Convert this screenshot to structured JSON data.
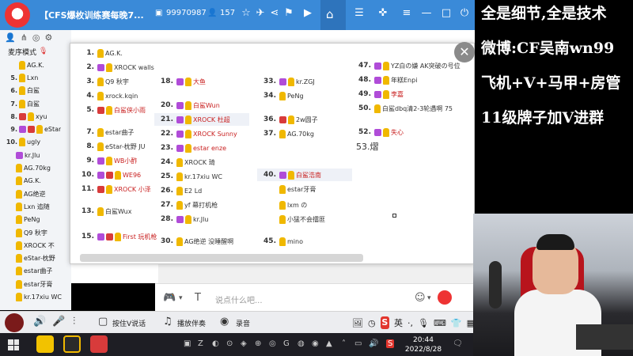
{
  "topbar": {
    "title": "【CFS爆枚训练赛每晚7...",
    "room_id": "99970987",
    "viewers": "157"
  },
  "left_panel": {
    "sort_label": "麦序模式",
    "rows": [
      {
        "num": "",
        "badges": [
          "cup"
        ],
        "name": "AG.K."
      },
      {
        "num": "5.",
        "badges": [
          "cup"
        ],
        "name": "Lxn"
      },
      {
        "num": "6.",
        "badges": [
          "cup"
        ],
        "name": "白鲨"
      },
      {
        "num": "7.",
        "badges": [
          "cup"
        ],
        "name": "白鲨"
      },
      {
        "num": "8.",
        "badges": [
          "red",
          "cup"
        ],
        "name": "xyu"
      },
      {
        "num": "9.",
        "badges": [
          "v",
          "red",
          "cup"
        ],
        "name": "eStar"
      },
      {
        "num": "10.",
        "badges": [
          "cup"
        ],
        "name": "ugly"
      }
    ],
    "sub_rows": [
      {
        "badges": [
          "v"
        ],
        "name": "kr.Jlu"
      },
      {
        "badges": [
          "cup"
        ],
        "name": "AG.70kg"
      },
      {
        "badges": [
          "cup"
        ],
        "name": "AG.K."
      },
      {
        "badges": [
          "cup"
        ],
        "name": "AG绝逆"
      },
      {
        "badges": [
          "cup"
        ],
        "name": "Lxn 追随"
      },
      {
        "badges": [
          "cup"
        ],
        "name": "PeNg"
      },
      {
        "badges": [
          "cup"
        ],
        "name": "Q9 秋宇"
      },
      {
        "badges": [
          "cup"
        ],
        "name": "XROCK 不"
      },
      {
        "badges": [
          "cup"
        ],
        "name": "eStar-枕野"
      },
      {
        "badges": [
          "cup"
        ],
        "name": "estar曲子"
      },
      {
        "badges": [
          "cup"
        ],
        "name": "estar牙膏"
      },
      {
        "badges": [
          "cup"
        ],
        "name": "kr.17xiu WC"
      }
    ]
  },
  "member_grid": [
    {
      "num": "1.",
      "badges": [
        "cup"
      ],
      "name": "AG.K.",
      "red": false
    },
    {
      "num": "2.",
      "badges": [
        "v",
        "cup"
      ],
      "name": "XROCK walls",
      "red": false
    },
    {
      "num": "3.",
      "badges": [
        "cup"
      ],
      "name": "Q9 秋宇",
      "red": false
    },
    {
      "num": "4.",
      "badges": [
        "cup"
      ],
      "name": "xrock.kqin",
      "red": false
    },
    {
      "num": "5.",
      "badges": [
        "red",
        "cup"
      ],
      "name": "白鲨侠小雨",
      "red": true
    },
    {
      "num": "7.",
      "badges": [
        "cup"
      ],
      "name": "estar曲子",
      "red": false
    },
    {
      "num": "8.",
      "badges": [
        "cup"
      ],
      "name": "eStar-枕野 JU",
      "red": false
    },
    {
      "num": "9.",
      "badges": [
        "v",
        "cup"
      ],
      "name": "WB小酢",
      "red": true
    },
    {
      "num": "10.",
      "badges": [
        "v",
        "red",
        "cup"
      ],
      "name": "WE96",
      "red": true
    },
    {
      "num": "11.",
      "badges": [
        "red",
        "cup"
      ],
      "name": "XROCK 小泽",
      "red": true
    },
    {
      "num": "13.",
      "badges": [
        "cup"
      ],
      "name": "白鲨Wux",
      "red": false
    },
    {
      "num": "15.",
      "badges": [
        "v",
        "red",
        "cup"
      ],
      "name": "First 玩机枪",
      "red": true
    },
    {
      "num": "18.",
      "badges": [
        "v",
        "cup"
      ],
      "name": "大鱼",
      "red": true
    },
    {
      "num": "20.",
      "badges": [
        "v",
        "cup"
      ],
      "name": "白鲨Wun",
      "red": true
    },
    {
      "num": "21.",
      "badges": [
        "v",
        "cup"
      ],
      "name": "XROCK 杜超",
      "red": true
    },
    {
      "num": "22.",
      "badges": [
        "v",
        "cup"
      ],
      "name": "XROCK Sunny",
      "red": true
    },
    {
      "num": "23.",
      "badges": [
        "v",
        "cup"
      ],
      "name": "estar enze",
      "red": true
    },
    {
      "num": "24.",
      "badges": [
        "cup"
      ],
      "name": "XROCK 琦",
      "red": false
    },
    {
      "num": "25.",
      "badges": [
        "cup"
      ],
      "name": "kr.17xiu WC",
      "red": false
    },
    {
      "num": "26.",
      "badges": [
        "cup"
      ],
      "name": "E2 Ld",
      "red": false
    },
    {
      "num": "27.",
      "badges": [
        "cup"
      ],
      "name": "yf 幕打机枪",
      "red": false
    },
    {
      "num": "28.",
      "badges": [
        "v",
        "cup"
      ],
      "name": "kr.Jlu",
      "red": false
    },
    {
      "num": "30.",
      "badges": [
        "cup"
      ],
      "name": "AG绝逆 没睡醒啊",
      "red": false
    },
    {
      "num": "33.",
      "badges": [
        "v",
        "cup"
      ],
      "name": "kr.ZGJ",
      "red": false
    },
    {
      "num": "34.",
      "badges": [
        "cup"
      ],
      "name": "PeNg",
      "red": false
    },
    {
      "num": "36.",
      "badges": [
        "red",
        "cup"
      ],
      "name": "2w圆子",
      "red": false
    },
    {
      "num": "37.",
      "badges": [
        "cup"
      ],
      "name": "AG.70kg",
      "red": false
    },
    {
      "num": "40.",
      "badges": [
        "v",
        "cup"
      ],
      "name": "白鲨浩南",
      "red": true
    },
    {
      "num": "",
      "badges": [
        "cup"
      ],
      "name": "estar牙膏",
      "red": false
    },
    {
      "num": "",
      "badges": [
        "cup"
      ],
      "name": "lxm の",
      "red": false
    },
    {
      "num": "",
      "badges": [
        "cup"
      ],
      "name": "小猛不会擂匪",
      "red": false
    },
    {
      "num": "45.",
      "badges": [
        "cup"
      ],
      "name": "mino",
      "red": false
    },
    {
      "num": "47.",
      "badges": [
        "v",
        "cup"
      ],
      "name": "YZ白の嫌 AK突破の号位",
      "red": false
    },
    {
      "num": "48.",
      "badges": [
        "v",
        "cup"
      ],
      "name": "年糕Enpi",
      "red": false
    },
    {
      "num": "49.",
      "badges": [
        "v",
        "cup"
      ],
      "name": "李嘉",
      "red": true
    },
    {
      "num": "50.",
      "badges": [
        "cup"
      ],
      "name": "白鲨dbq清2-3轮遇啊 75",
      "red": false
    },
    {
      "num": "52.",
      "badges": [
        "v",
        "cup"
      ],
      "name": "失心",
      "red": true
    }
  ],
  "popup_note": "53.熠",
  "input": {
    "placeholder": "说点什么吧..."
  },
  "controls": {
    "ptt_label": "按住V说话",
    "music_label": "播放伴奏",
    "record_label": "录音",
    "ime_label": "英"
  },
  "clock": {
    "time": "20:44",
    "date": "2022/8/28"
  },
  "overlay_text": [
    "全是细节,全是技术",
    "微博:CF吴南wn99",
    "飞机+V+马甲+房管",
    "11级牌子加V进群"
  ]
}
